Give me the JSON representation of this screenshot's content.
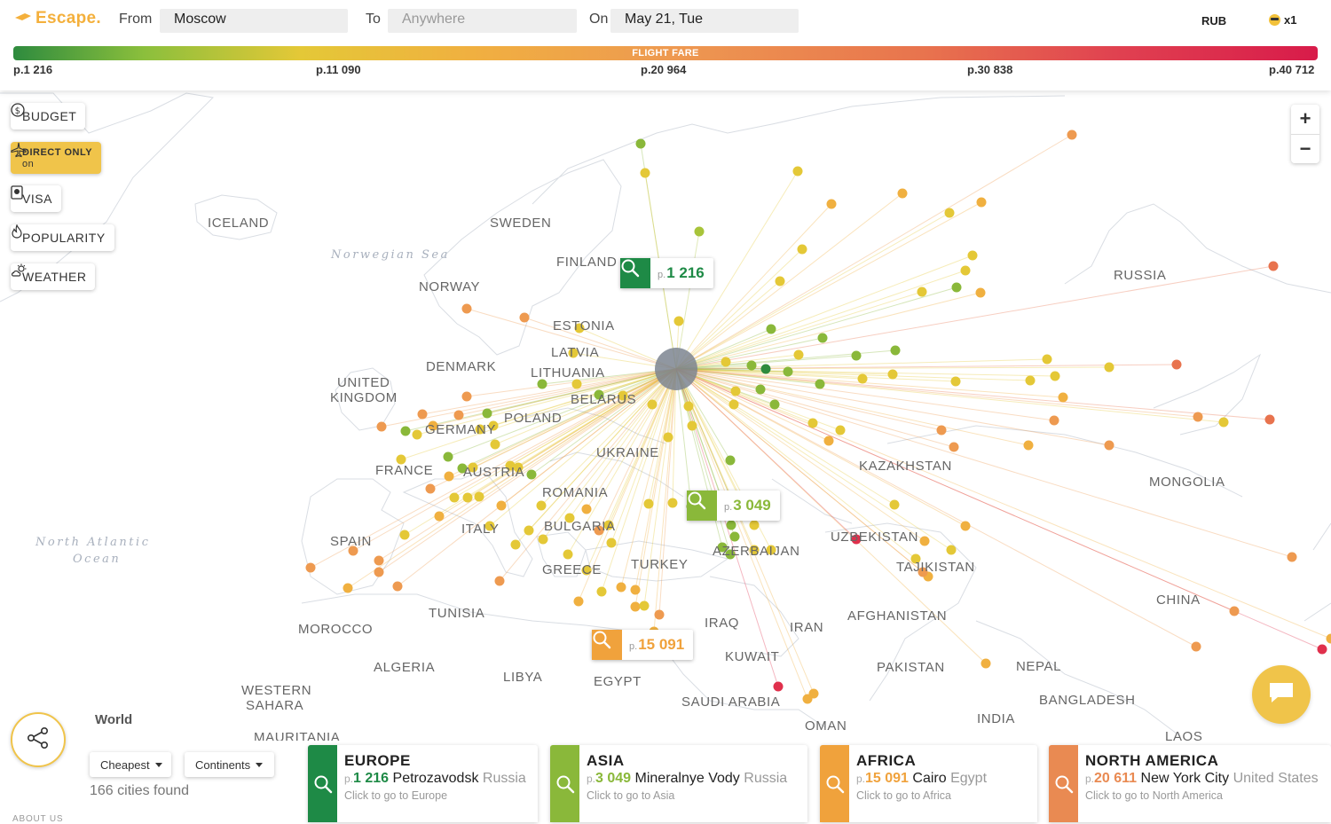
{
  "header": {
    "logo": "Escape.",
    "from_label": "From",
    "from_value": "Moscow",
    "to_label": "To",
    "to_placeholder": "Anywhere",
    "on_label": "On",
    "date_value": "May 21, Tue",
    "currency": "RUB",
    "passengers": "x1"
  },
  "fare_scale": {
    "title": "FLIGHT FARE",
    "ticks": [
      "p.1 216",
      "p.11 090",
      "p.20 964",
      "p.30 838",
      "p.40 712"
    ]
  },
  "filters": {
    "budget": "BUDGET",
    "direct_title": "DIRECT ONLY",
    "direct_state": "on",
    "visa": "VISA",
    "popularity": "POPULARITY",
    "weather": "WEATHER"
  },
  "zoom": {
    "in": "+",
    "out": "−"
  },
  "map": {
    "countries": [
      "ICELAND",
      "SWEDEN",
      "FINLAND",
      "NORWAY",
      "RUSSIA",
      "ESTONIA",
      "LATVIA",
      "DENMARK",
      "LITHUANIA",
      "UNITED",
      "KINGDOM",
      "BELARUS",
      "POLAND",
      "GERMANY",
      "UKRAINE",
      "FRANCE",
      "AUSTRIA",
      "KAZAKHSTAN",
      "ROMANIA",
      "MONGOLIA",
      "BULGARIA",
      "ITALY",
      "SPAIN",
      "UZBEKISTAN",
      "AZERBAIJAN",
      "GREECE",
      "TURKEY",
      "TAJIKISTAN",
      "CHINA",
      "TUNISIA",
      "AFGHANISTAN",
      "MOROCCO",
      "IRAQ",
      "IRAN",
      "ALGERIA",
      "LIBYA",
      "KUWAIT",
      "PAKISTAN",
      "NEPAL",
      "EGYPT",
      "WESTERN",
      "SAHARA",
      "SAUDI ARABIA",
      "BANGLADESH",
      "INDIA",
      "OMAN",
      "MAURITANIA",
      "LAOS"
    ],
    "seas": [
      "Norwegian Sea",
      "North Atlantic",
      "Ocean"
    ]
  },
  "pins": [
    {
      "prefix": "p.",
      "price": "1 216",
      "color": "#1e8a46"
    },
    {
      "prefix": "p.",
      "price": "3 049",
      "color": "#8ab83a"
    },
    {
      "prefix": "p.",
      "price": "15 091",
      "color": "#f0a23c"
    }
  ],
  "bottom": {
    "world": "World",
    "sort": "Cheapest",
    "group": "Continents",
    "found": "166 cities found",
    "about": "ABOUT US"
  },
  "cards": [
    {
      "region": "EUROPE",
      "prefix": "p.",
      "price": "1 216",
      "city": "Petrozavodsk",
      "country": "Russia",
      "go": "Click to go to Europe",
      "color": "#1e8a46"
    },
    {
      "region": "ASIA",
      "prefix": "p.",
      "price": "3 049",
      "city": "Mineralnye Vody",
      "country": "Russia",
      "go": "Click to go to Asia",
      "color": "#8ab83a"
    },
    {
      "region": "AFRICA",
      "prefix": "p.",
      "price": "15 091",
      "city": "Cairo",
      "country": "Egypt",
      "go": "Click to go to Africa",
      "color": "#f0a23c"
    },
    {
      "region": "NORTH AMERICA",
      "prefix": "p.",
      "price": "20 611",
      "city": "New York City",
      "country": "United States",
      "go": "Click to go to North America",
      "color": "#e98a52"
    }
  ]
}
